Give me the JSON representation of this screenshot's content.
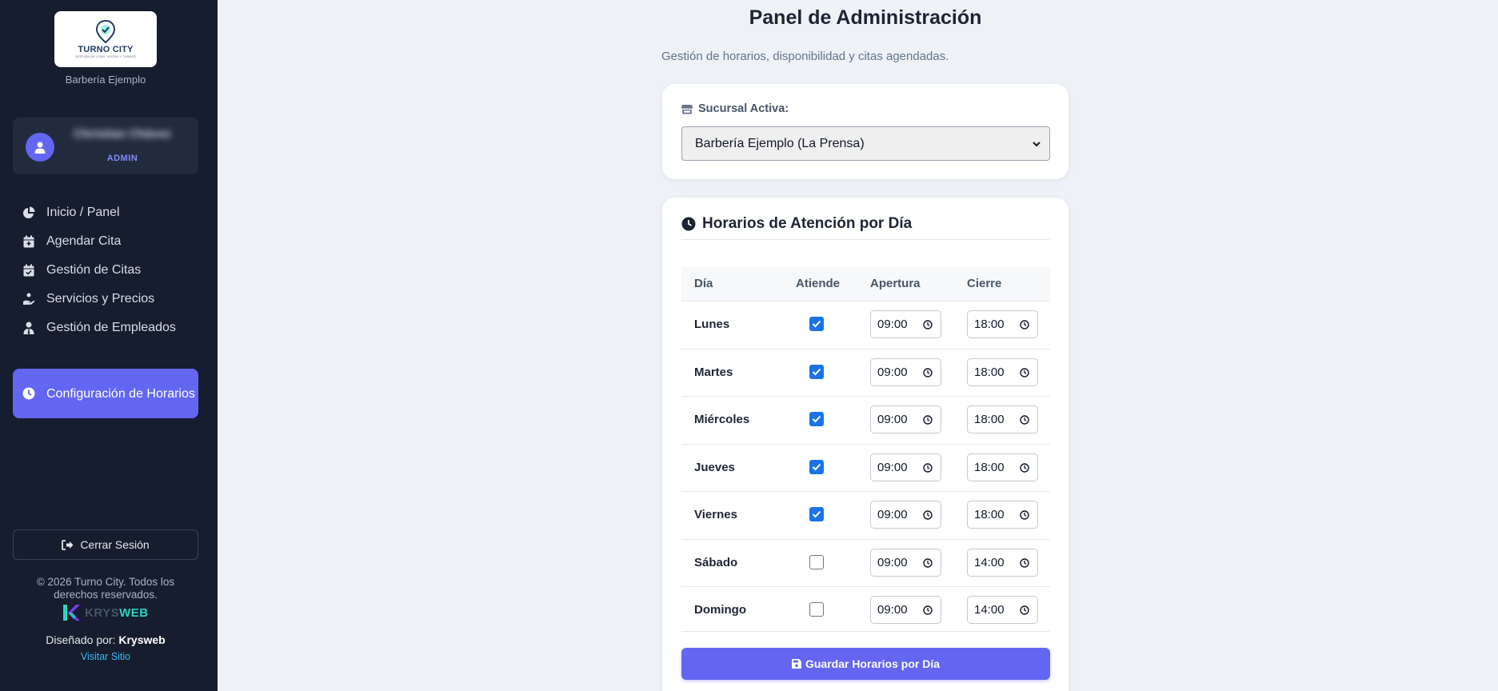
{
  "sidebar": {
    "logo": {
      "text": "TURNO CITY",
      "tagline": "GESTIÓN DE CITAS, VISITAS Y TURNOS"
    },
    "brand_name": "Barbería Ejemplo",
    "user": {
      "name": "Christian Chávez",
      "role": "ADMIN"
    },
    "nav": [
      {
        "label": "Inicio / Panel",
        "icon": "chart-pie-icon"
      },
      {
        "label": "Agendar Cita",
        "icon": "calendar-plus-icon"
      },
      {
        "label": "Gestión de Citas",
        "icon": "calendar-check-icon"
      },
      {
        "label": "Servicios y Precios",
        "icon": "hand-holding-icon"
      },
      {
        "label": "Gestión de Empleados",
        "icon": "user-tie-icon"
      },
      {
        "label": "Configuración de Horarios",
        "icon": "clock-icon",
        "active": true
      }
    ],
    "logout_label": "Cerrar Sesión",
    "copyright": "© 2026 Turno City. Todos los derechos reservados.",
    "designer_logo": {
      "part1": "KRYS",
      "part2": "WEB"
    },
    "designed_by_prefix": "Diseñado por:",
    "designed_by_name": "Krysweb",
    "visit_label": "Visitar Sitio"
  },
  "main": {
    "title": "Panel de Administración",
    "subtitle": "Gestión de horarios, disponibilidad y citas agendadas.",
    "branch": {
      "label": "Sucursal Activa:",
      "selected": "Barbería Ejemplo (La Prensa)"
    },
    "hours": {
      "title": "Horarios de Atención por Día",
      "columns": {
        "day": "Día",
        "attends": "Atiende",
        "open": "Apertura",
        "close": "Cierre"
      },
      "rows": [
        {
          "day": "Lunes",
          "attends": true,
          "open": "09:00",
          "close": "18:00"
        },
        {
          "day": "Martes",
          "attends": true,
          "open": "09:00",
          "close": "18:00"
        },
        {
          "day": "Miércoles",
          "attends": true,
          "open": "09:00",
          "close": "18:00"
        },
        {
          "day": "Jueves",
          "attends": true,
          "open": "09:00",
          "close": "18:00"
        },
        {
          "day": "Viernes",
          "attends": true,
          "open": "09:00",
          "close": "18:00"
        },
        {
          "day": "Sábado",
          "attends": false,
          "open": "09:00",
          "close": "14:00"
        },
        {
          "day": "Domingo",
          "attends": false,
          "open": "09:00",
          "close": "14:00"
        }
      ],
      "save_label": "Guardar Horarios por Día"
    }
  },
  "colors": {
    "sidebar_bg": "#161d2e",
    "accent": "#6366f1",
    "checkbox_on": "#1a73e8",
    "page_bg": "#eef1f6"
  }
}
